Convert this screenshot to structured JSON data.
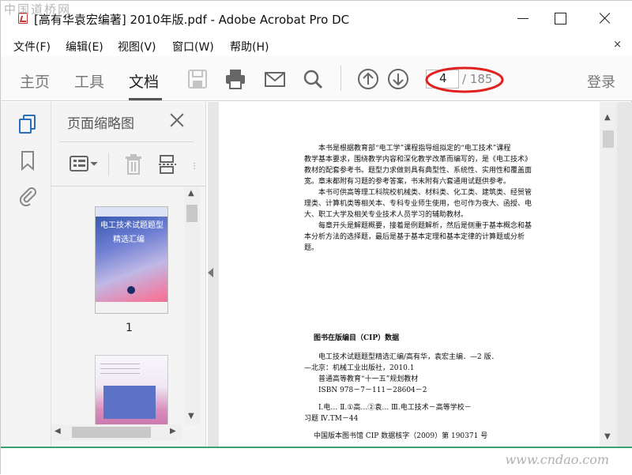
{
  "watermarks": {
    "top": "中国道桥网",
    "bottom": "www.cndao.com"
  },
  "window": {
    "title": "[高有华袁宏编著] 2010年版.pdf - Adobe Acrobat Pro DC"
  },
  "menu": {
    "items": [
      "文件(F)",
      "编辑(E)",
      "视图(V)",
      "窗口(W)",
      "帮助(H)"
    ],
    "close_glyph": "×"
  },
  "toolbar": {
    "tabs": [
      "主页",
      "工具",
      "文档"
    ],
    "active_tab": "文档",
    "page_current": "4",
    "page_total": "/ 185",
    "login": "登录",
    "annotation_color": "#e32020"
  },
  "thumbnail_panel": {
    "title": "页面缩略图",
    "thumb1_label": "1",
    "thumb1_cover_title": "电工技术试题题型",
    "thumb1_cover_subtitle": "精选汇编"
  },
  "document": {
    "paragraphs": [
      "本书是根据教育部“电工学”课程指导组拟定的“电工技术”课程",
      "教学基本要求，围绕教学内容和深化教学改革而编写的，是《电工技术》",
      "教材的配套参考书。题型力求做到具有典型性、系统性、实用性和覆盖面",
      "宽。章末都附有习题的参考答案，书末附有六套通用试题供参考。",
      "本书可供高等理工科院校机械类、材料类、化工类、建筑类、经贸管",
      "理类、计算机类等相关本、专科专业师生使用，也可作为夜大、函授、电",
      "大、职工大学及相关专业技术人员学习的辅助教材。",
      "每章开头是解题概要，接着是例题解析，然后是侧重于基本概念和基",
      "本分析方法的选择题，最后是基于基本定理和基本定律的计算题或分析",
      "题。"
    ],
    "cip_heading": "图书在版编目（CIP）数据",
    "cip_lines": [
      "电工技术试题题型精选汇编/高有华，袁宏主编．—2 版．",
      "—北京：机械工业出版社，2010.1",
      "普通高等教育“十一五”规划教材",
      "ISBN 978－7－111－28604－2",
      "Ⅰ.电…  Ⅱ.①高…②袁…  Ⅲ.电工技术－高等学校－",
      "习题  Ⅳ.TM－44"
    ],
    "cip_footer": "中国版本图书馆 CIP 数据核字（2009）第 190371 号"
  }
}
